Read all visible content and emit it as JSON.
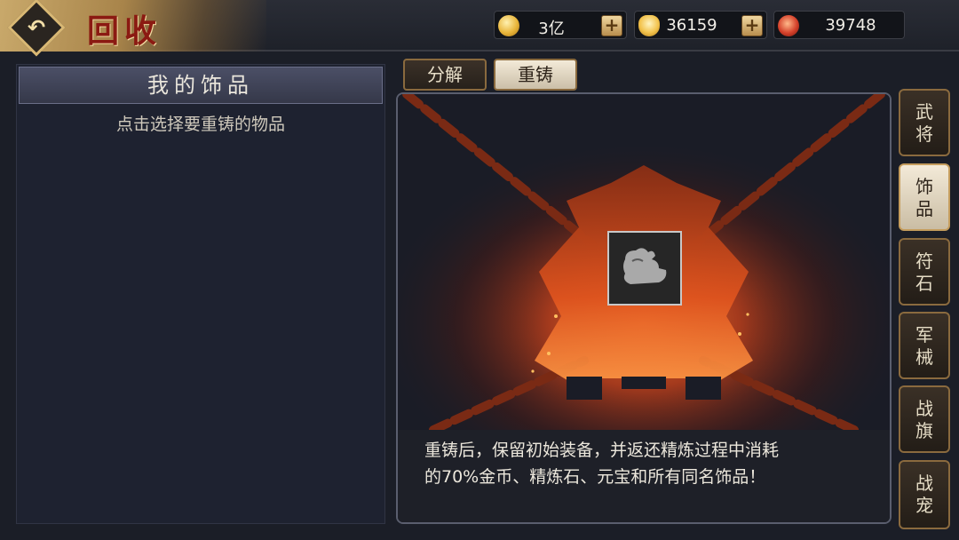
{
  "header": {
    "title": "回收",
    "back_icon": "back-arrow-icon"
  },
  "currencies": [
    {
      "name": "copper-coin",
      "icon": "coin-icon",
      "value": "3亿",
      "has_plus": true,
      "color": "#e9b53a"
    },
    {
      "name": "gold-ingot",
      "icon": "ingot-icon",
      "value": "36159",
      "has_plus": true,
      "color": "#f2c24c"
    },
    {
      "name": "refine-stone",
      "icon": "stone-icon",
      "value": "39748",
      "has_plus": false,
      "color": "#d4402a"
    }
  ],
  "left_panel": {
    "title": "我的饰品",
    "hint": "点击选择要重铸的物品"
  },
  "tabs": [
    {
      "label": "分解",
      "active": false
    },
    {
      "label": "重铸",
      "active": true
    }
  ],
  "center": {
    "slot_icon": "ornament-icon",
    "description_line1": "重铸后，保留初始装备，并返还精炼过程中消耗",
    "description_line2": "的70%金币、精炼石、元宝和所有同名饰品！"
  },
  "categories": [
    {
      "label": "武将",
      "active": false
    },
    {
      "label": "饰品",
      "active": true
    },
    {
      "label": "符石",
      "active": false
    },
    {
      "label": "军械",
      "active": false
    },
    {
      "label": "战旗",
      "active": false
    },
    {
      "label": "战宠",
      "active": false
    }
  ],
  "colors": {
    "accent_gold": "#c59d5d",
    "furnace_glow": "#e0541e",
    "title_red": "#8b1a12"
  }
}
